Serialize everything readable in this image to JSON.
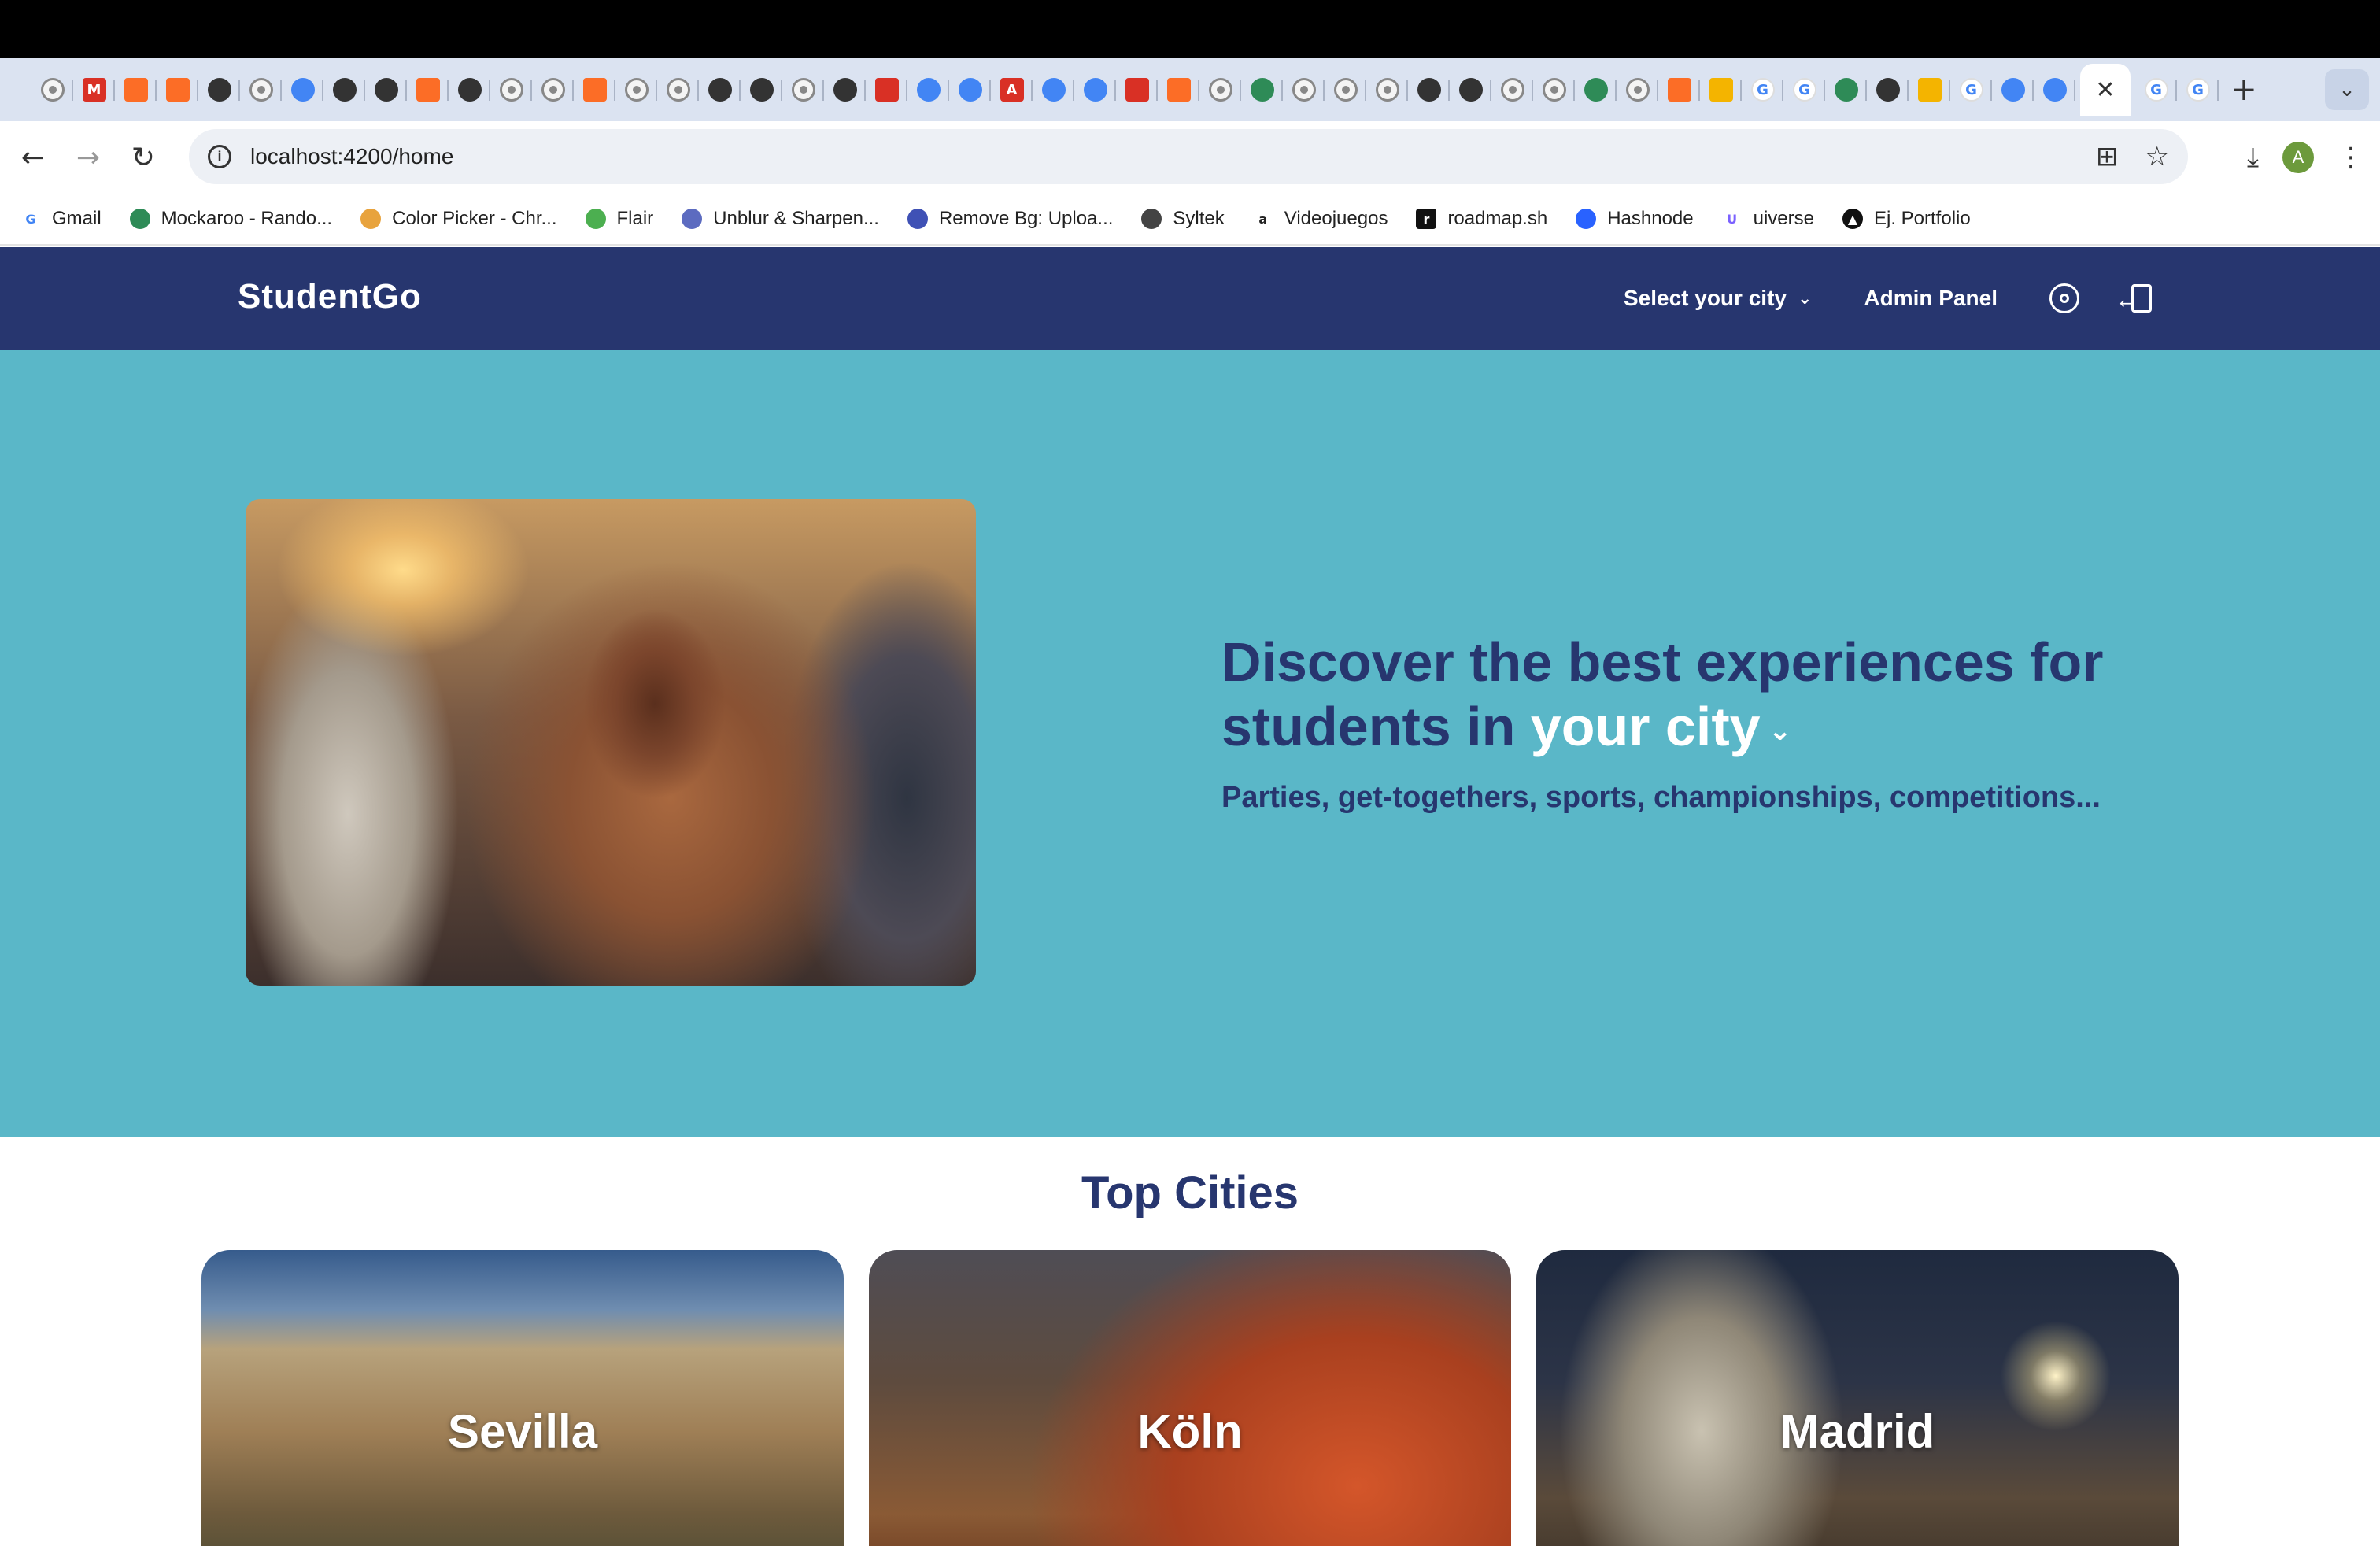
{
  "browser": {
    "tabs_count_note": "",
    "address": {
      "url": "localhost:4200/home"
    },
    "bookmarks": [
      {
        "label": "Gmail",
        "icon": "google-icon",
        "color": "#4285f4"
      },
      {
        "label": "Mockaroo - Rando...",
        "icon": "mockaroo-icon",
        "color": "#2e8b57"
      },
      {
        "label": "Color Picker - Chr...",
        "icon": "color-picker-icon",
        "color": "#e8a33d"
      },
      {
        "label": "Flair",
        "icon": "flair-icon",
        "color": "#4caf50"
      },
      {
        "label": "Unblur & Sharpen...",
        "icon": "unblur-icon",
        "color": "#5c6bc0"
      },
      {
        "label": "Remove Bg: Uploa...",
        "icon": "remove-bg-icon",
        "color": "#3f51b5"
      },
      {
        "label": "Syltek",
        "icon": "globe-icon",
        "color": "#444444"
      },
      {
        "label": "Videojuegos",
        "icon": "amazon-icon",
        "color": "#222222"
      },
      {
        "label": "roadmap.sh",
        "icon": "roadmap-icon",
        "color": "#111111"
      },
      {
        "label": "Hashnode",
        "icon": "hashnode-icon",
        "color": "#2962ff"
      },
      {
        "label": "uiverse",
        "icon": "uiverse-icon",
        "color": "#7b61ff"
      },
      {
        "label": "Ej. Portfolio",
        "icon": "portfolio-icon",
        "color": "#111111"
      }
    ],
    "profile_initial": "A"
  },
  "app": {
    "brand": "StudentGo",
    "nav": {
      "select_city": "Select your city",
      "admin_panel": "Admin Panel"
    },
    "hero": {
      "title_prefix": "Discover the best experiences for students in ",
      "title_city": "your city",
      "subtitle": "Parties, get-togethers, sports, championships, competitions..."
    },
    "top_cities": {
      "title": "Top Cities",
      "cities": [
        {
          "name": "Sevilla"
        },
        {
          "name": "Köln"
        },
        {
          "name": "Madrid"
        }
      ]
    },
    "colors": {
      "header": "#27366f",
      "hero_bg": "#5ab7c8",
      "accent_text": "#27366f"
    }
  }
}
